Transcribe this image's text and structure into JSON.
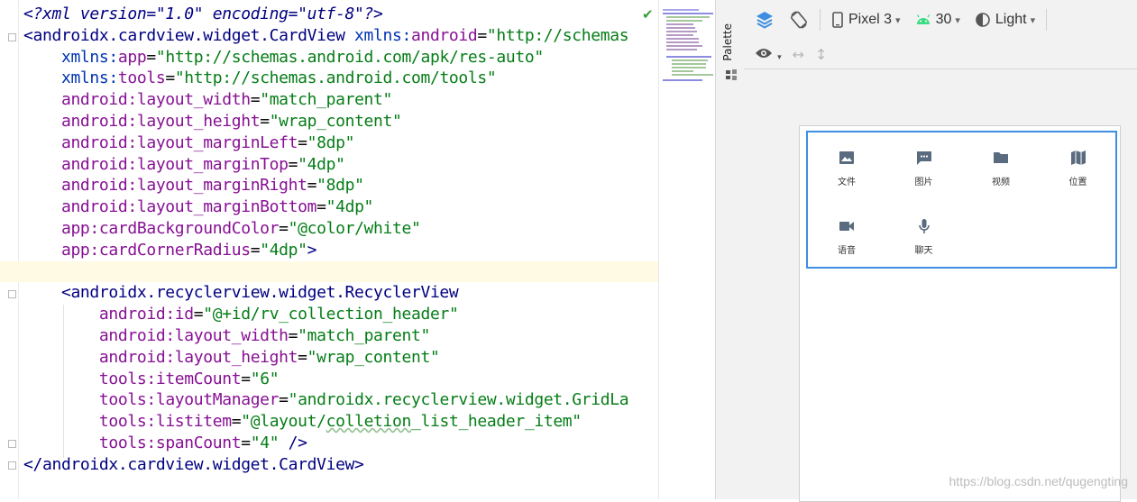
{
  "editor": {
    "lines": [
      [
        {
          "t": "<?xml version=\"1.0\" encoding=\"utf-8\"?>",
          "c": "decl"
        }
      ],
      [
        {
          "t": "<androidx.cardview.widget.CardView ",
          "c": "dark"
        },
        {
          "t": "xmlns:",
          "c": "ns"
        },
        {
          "t": "android",
          "c": "attr"
        },
        {
          "t": "=",
          "c": "punct"
        },
        {
          "t": "\"http://schemas",
          "c": "str"
        }
      ],
      [
        {
          "t": "    "
        },
        {
          "t": "xmlns:",
          "c": "ns"
        },
        {
          "t": "app",
          "c": "attr"
        },
        {
          "t": "=",
          "c": "punct"
        },
        {
          "t": "\"http://schemas.android.com/apk/res-auto\"",
          "c": "str"
        }
      ],
      [
        {
          "t": "    "
        },
        {
          "t": "xmlns:",
          "c": "ns"
        },
        {
          "t": "tools",
          "c": "attr"
        },
        {
          "t": "=",
          "c": "punct"
        },
        {
          "t": "\"http://schemas.android.com/tools\"",
          "c": "str"
        }
      ],
      [
        {
          "t": "    "
        },
        {
          "t": "android:layout_width",
          "c": "attr"
        },
        {
          "t": "=",
          "c": "punct"
        },
        {
          "t": "\"match_parent\"",
          "c": "str"
        }
      ],
      [
        {
          "t": "    "
        },
        {
          "t": "android:layout_height",
          "c": "attr"
        },
        {
          "t": "=",
          "c": "punct"
        },
        {
          "t": "\"wrap_content\"",
          "c": "str"
        }
      ],
      [
        {
          "t": "    "
        },
        {
          "t": "android:layout_marginLeft",
          "c": "attr"
        },
        {
          "t": "=",
          "c": "punct"
        },
        {
          "t": "\"8dp\"",
          "c": "str hl"
        }
      ],
      [
        {
          "t": "    "
        },
        {
          "t": "android:layout_marginTop",
          "c": "attr"
        },
        {
          "t": "=",
          "c": "punct"
        },
        {
          "t": "\"4dp\"",
          "c": "str"
        }
      ],
      [
        {
          "t": "    "
        },
        {
          "t": "android:layout_marginRight",
          "c": "attr"
        },
        {
          "t": "=",
          "c": "punct"
        },
        {
          "t": "\"8dp\"",
          "c": "str hl"
        }
      ],
      [
        {
          "t": "    "
        },
        {
          "t": "android:layout_marginBottom",
          "c": "attr"
        },
        {
          "t": "=",
          "c": "punct"
        },
        {
          "t": "\"4dp\"",
          "c": "str hl"
        }
      ],
      [
        {
          "t": "    "
        },
        {
          "t": "app:cardBackgroundColor",
          "c": "attr"
        },
        {
          "t": "=",
          "c": "punct"
        },
        {
          "t": "\"@color/white\"",
          "c": "str"
        }
      ],
      [
        {
          "t": "    "
        },
        {
          "t": "app:cardCornerRadius",
          "c": "attr"
        },
        {
          "t": "=",
          "c": "punct"
        },
        {
          "t": "\"4dp\"",
          "c": "str hl"
        },
        {
          "t": ">",
          "c": "dark"
        }
      ],
      [],
      [
        {
          "t": "    "
        },
        {
          "t": "<androidx.recyclerview.widget.RecyclerView",
          "c": "dark"
        }
      ],
      [
        {
          "t": "        "
        },
        {
          "t": "android:id",
          "c": "attr"
        },
        {
          "t": "=",
          "c": "punct"
        },
        {
          "t": "\"@+id/rv_collection_header\"",
          "c": "str"
        }
      ],
      [
        {
          "t": "        "
        },
        {
          "t": "android:layout_width",
          "c": "attr"
        },
        {
          "t": "=",
          "c": "punct"
        },
        {
          "t": "\"match_parent\"",
          "c": "str"
        }
      ],
      [
        {
          "t": "        "
        },
        {
          "t": "android:layout_height",
          "c": "attr"
        },
        {
          "t": "=",
          "c": "punct"
        },
        {
          "t": "\"wrap_content\"",
          "c": "str"
        }
      ],
      [
        {
          "t": "        "
        },
        {
          "t": "tools:itemCount",
          "c": "attr"
        },
        {
          "t": "=",
          "c": "punct"
        },
        {
          "t": "\"6\"",
          "c": "str"
        }
      ],
      [
        {
          "t": "        "
        },
        {
          "t": "tools:layoutManager",
          "c": "attr"
        },
        {
          "t": "=",
          "c": "punct"
        },
        {
          "t": "\"androidx.recyclerview.widget.GridLa",
          "c": "str"
        }
      ],
      [
        {
          "t": "        "
        },
        {
          "t": "tools:listitem",
          "c": "attr"
        },
        {
          "t": "=",
          "c": "punct"
        },
        {
          "t": "\"@layout/",
          "c": "str"
        },
        {
          "t": "colletion",
          "c": "str under"
        },
        {
          "t": "_list_header_item\"",
          "c": "str"
        }
      ],
      [
        {
          "t": "        "
        },
        {
          "t": "tools:spanCount",
          "c": "attr"
        },
        {
          "t": "=",
          "c": "punct"
        },
        {
          "t": "\"4\"",
          "c": "str"
        },
        {
          "t": " />",
          "c": "dark"
        }
      ],
      [
        {
          "t": "</androidx.cardview.widget.CardView>",
          "c": "dark"
        }
      ]
    ],
    "current_line": 12,
    "validation_icon": "check-icon"
  },
  "sidebar": {
    "palette_label": "Palette"
  },
  "design_toolbar": {
    "device": "Pixel 3",
    "api": "30",
    "theme": "Light"
  },
  "preview": {
    "items": [
      {
        "label": "文件",
        "icon": "image-icon"
      },
      {
        "label": "图片",
        "icon": "chat-icon"
      },
      {
        "label": "视频",
        "icon": "folder-icon"
      },
      {
        "label": "位置",
        "icon": "map-icon"
      },
      {
        "label": "语音",
        "icon": "videocam-icon"
      },
      {
        "label": "聊天",
        "icon": "mic-icon"
      }
    ]
  },
  "watermark": "https://blog.csdn.net/qugengting",
  "colors": {
    "accent": "#3d8ee0",
    "icon": "#5a6b80",
    "android_green": "#3ddc84"
  }
}
